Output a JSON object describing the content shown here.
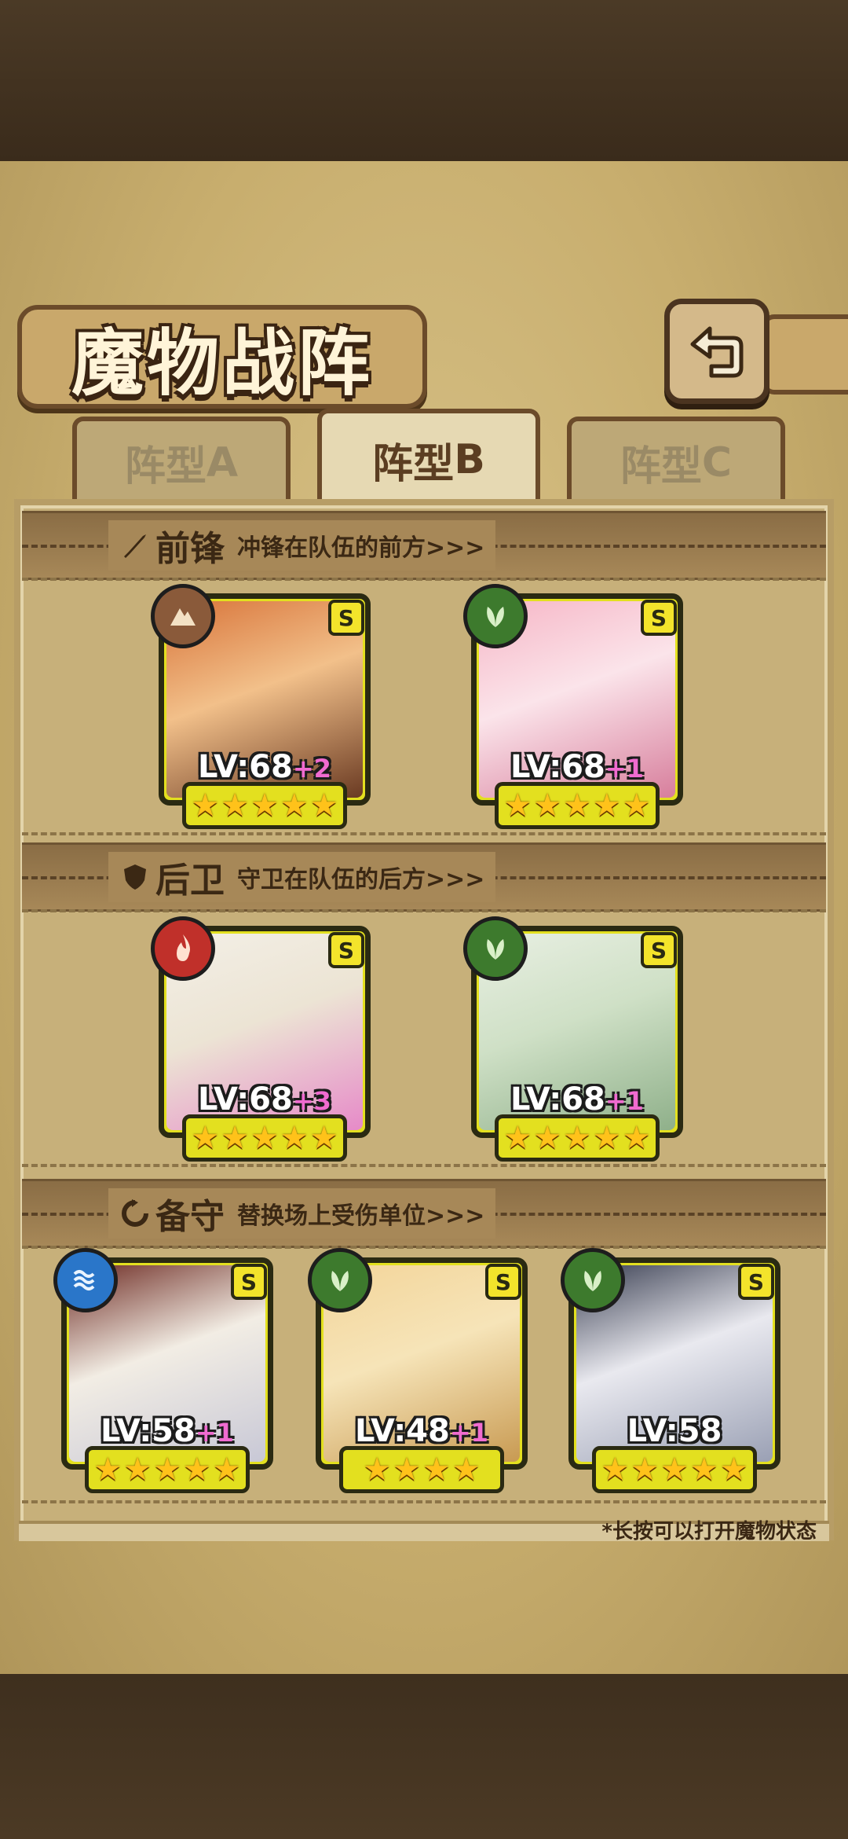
{
  "page": {
    "title": "魔物战阵"
  },
  "tabs": [
    {
      "label": "阵型",
      "suffix": "A",
      "active": false
    },
    {
      "label": "阵型",
      "suffix": "B",
      "active": true
    },
    {
      "label": "阵型",
      "suffix": "C",
      "active": false
    }
  ],
  "sections": {
    "front": {
      "icon": "sword-icon",
      "title": "前锋",
      "desc": "冲锋在队伍的前方>>>"
    },
    "rear": {
      "icon": "shield-icon",
      "title": "后卫",
      "desc": "守卫在队伍的后方>>>"
    },
    "reserve": {
      "icon": "swap-icon",
      "title": "备守",
      "desc": "替换场上受伤单位>>>"
    }
  },
  "cards": {
    "front_1": {
      "rank": "S",
      "element": "earth",
      "element_color": "#8a5a3a",
      "level": "LV:68",
      "plus": "+2",
      "stars": 5
    },
    "front_2": {
      "rank": "S",
      "element": "leaf",
      "element_color": "#3d7a2d",
      "level": "LV:68",
      "plus": "+1",
      "stars": 5
    },
    "rear_1": {
      "rank": "S",
      "element": "fire",
      "element_color": "#c0302a",
      "level": "LV:68",
      "plus": "+3",
      "stars": 5
    },
    "rear_2": {
      "rank": "S",
      "element": "leaf",
      "element_color": "#3d7a2d",
      "level": "LV:68",
      "plus": "+1",
      "stars": 5
    },
    "reserve_1": {
      "rank": "S",
      "element": "water",
      "element_color": "#2a76c9",
      "level": "LV:58",
      "plus": "+1",
      "stars": 5
    },
    "reserve_2": {
      "rank": "S",
      "element": "leaf",
      "element_color": "#3d7a2d",
      "level": "LV:48",
      "plus": "+1",
      "stars": 4
    },
    "reserve_3": {
      "rank": "S",
      "element": "leaf",
      "element_color": "#3d7a2d",
      "level": "LV:58",
      "plus": "",
      "stars": 5
    }
  },
  "hint": "*长按可以打开魔物状态"
}
